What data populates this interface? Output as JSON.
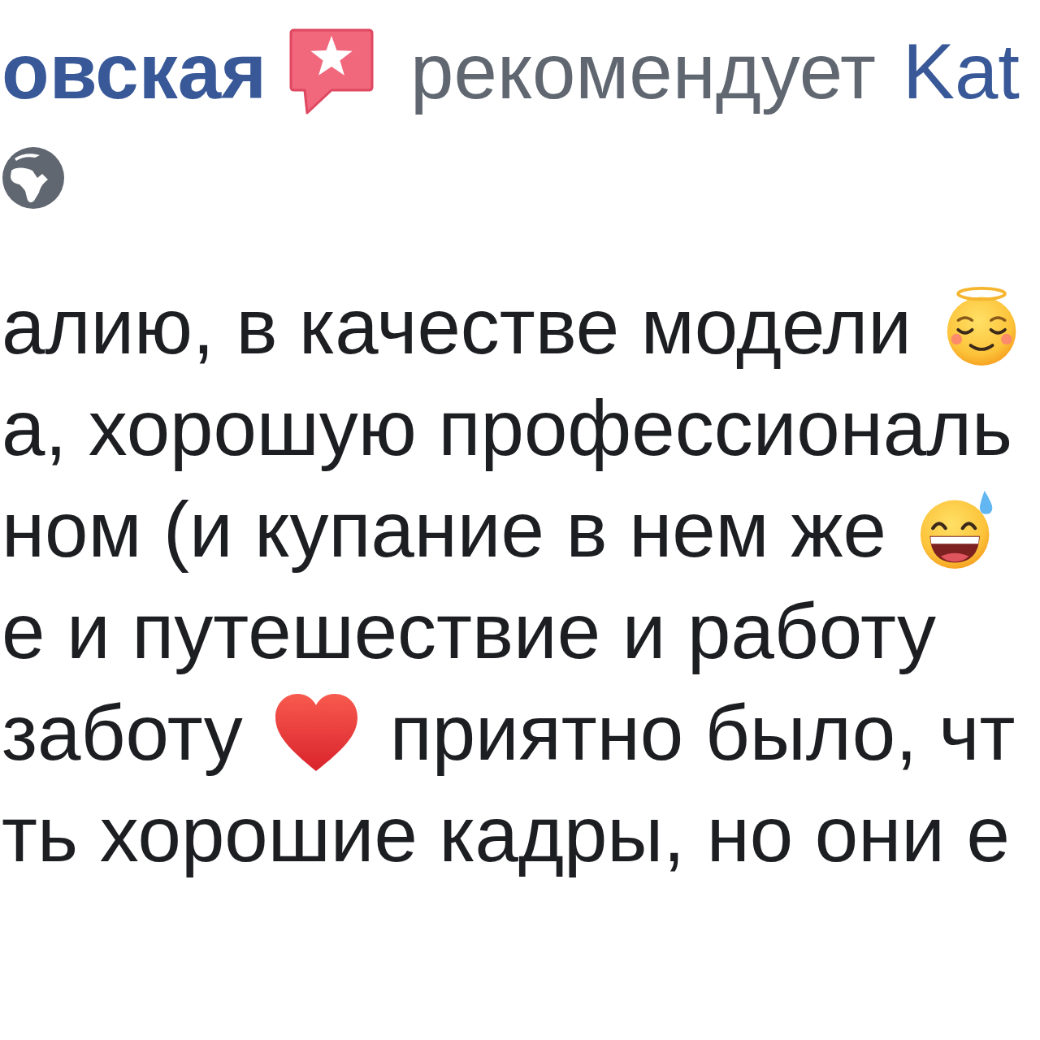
{
  "post": {
    "author": "овская",
    "action": "рекомендует",
    "page": "Kat",
    "lines": [
      [
        {
          "kind": "text",
          "text": "алию, в качестве модели"
        },
        {
          "kind": "halo"
        }
      ],
      [
        {
          "kind": "text",
          "text": "а, хорошую профессиональ"
        }
      ],
      [
        {
          "kind": "text",
          "text": "ном (и купание в нем же"
        },
        {
          "kind": "sweat"
        }
      ],
      [
        {
          "kind": "text",
          "text": "е и путешествие и работу"
        }
      ],
      [
        {
          "kind": "text",
          "text": "заботу"
        },
        {
          "kind": "heart"
        },
        {
          "kind": "text",
          "text": "приятно было, чт"
        }
      ],
      [
        {
          "kind": "text",
          "text": "ть хорошие кадры, но они е"
        }
      ]
    ]
  }
}
